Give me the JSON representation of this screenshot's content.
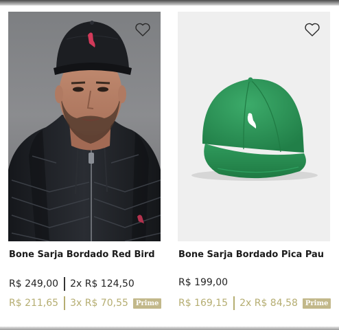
{
  "products": [
    {
      "title": "Bone Sarja Bordado Red Bird",
      "price": "R$ 249,00",
      "installments": "2x R$ 124,50",
      "prime_price": "R$ 211,65",
      "prime_installments": "3x R$ 70,55",
      "badge": "Prime",
      "image": "man-wearing-black-cap-photo",
      "favorite_icon": "heart-outline-icon"
    },
    {
      "title": "Bone Sarja  Bordado Pica Pau",
      "price": "R$ 199,00",
      "installments": "",
      "prime_price": "R$ 169,15",
      "prime_installments": "2x R$ 84,58",
      "badge": "Prime",
      "image": "green-cap-photo",
      "favorite_icon": "heart-outline-icon"
    }
  ],
  "colors": {
    "prime_text": "#b5ad71",
    "prime_badge": "#c2b88a",
    "cap_green": "#2e9a5c",
    "cap_black": "#1c1e22",
    "bird_red": "#d23a5a"
  }
}
